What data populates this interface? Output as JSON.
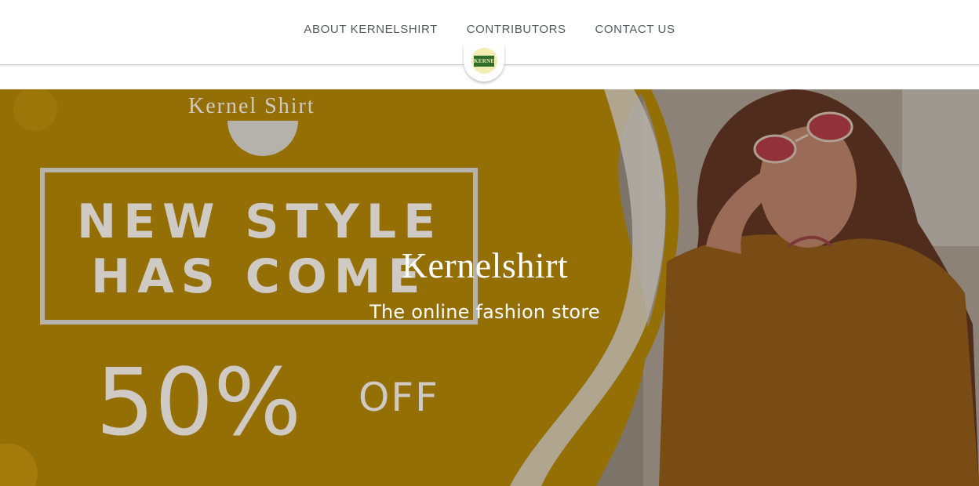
{
  "nav": {
    "items": [
      {
        "label": "ABOUT KERNELSHIRT"
      },
      {
        "label": "CONTRIBUTORS"
      },
      {
        "label": "CONTACT US"
      }
    ]
  },
  "logo": {
    "text": "KERNEL"
  },
  "banner": {
    "brand": "Kernel Shirt",
    "line1": "NEW STYLE",
    "line2": "HAS COME",
    "discount": "50%",
    "off": "OFF"
  },
  "hero": {
    "title": "Kernelshirt",
    "subtitle": "The online fashion store"
  },
  "colors": {
    "banner_yellow": "#a97f07",
    "sweater": "#7a4a14",
    "text_light": "#d8d8d8"
  }
}
